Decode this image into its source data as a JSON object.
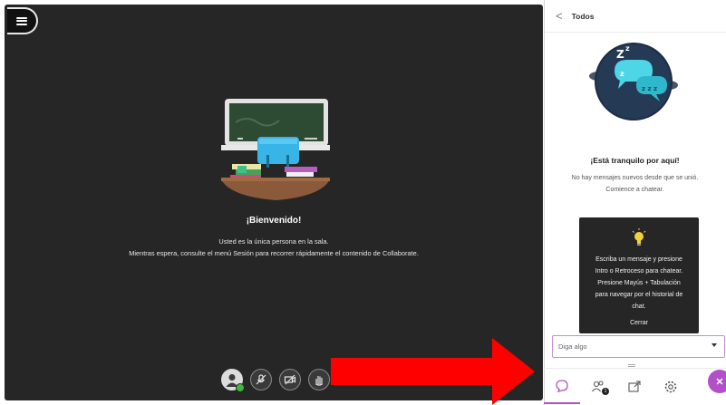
{
  "stage": {
    "welcome_title": "¡Bienvenido!",
    "welcome_line1": "Usted es la única persona en la sala.",
    "welcome_line2": "Mientras espera, consulte el menú Sesión para recorrer rápidamente el contenido de Collaborate.",
    "menu_icon": "hamburger-menu-icon",
    "controls": [
      {
        "icon": "avatar-icon",
        "status": "green-check"
      },
      {
        "icon": "microphone-off-icon"
      },
      {
        "icon": "camera-off-icon"
      },
      {
        "icon": "raise-hand-icon"
      }
    ]
  },
  "panel": {
    "back_label": "<",
    "title": "Todos",
    "quiet_title": "¡Está tranquilo por aquí!",
    "quiet_line1": "No hay mensajes nuevos desde que se unió.",
    "quiet_line2": "Comience a chatear.",
    "tip_line1": "Escriba un mensaje y presione",
    "tip_line2": "Intro o Retroceso para chatear.",
    "tip_line3": "Presione Mayús + Tabulación",
    "tip_line4": "para navegar por el historial de",
    "tip_line5": "chat.",
    "tip_close": "Cerrar",
    "input_placeholder": "Diga algo",
    "participants_badge": "1"
  },
  "colors": {
    "stage_bg": "#262626",
    "accent": "#b24fc9",
    "arrow": "#ff0000",
    "status_green": "#3fb73a"
  }
}
